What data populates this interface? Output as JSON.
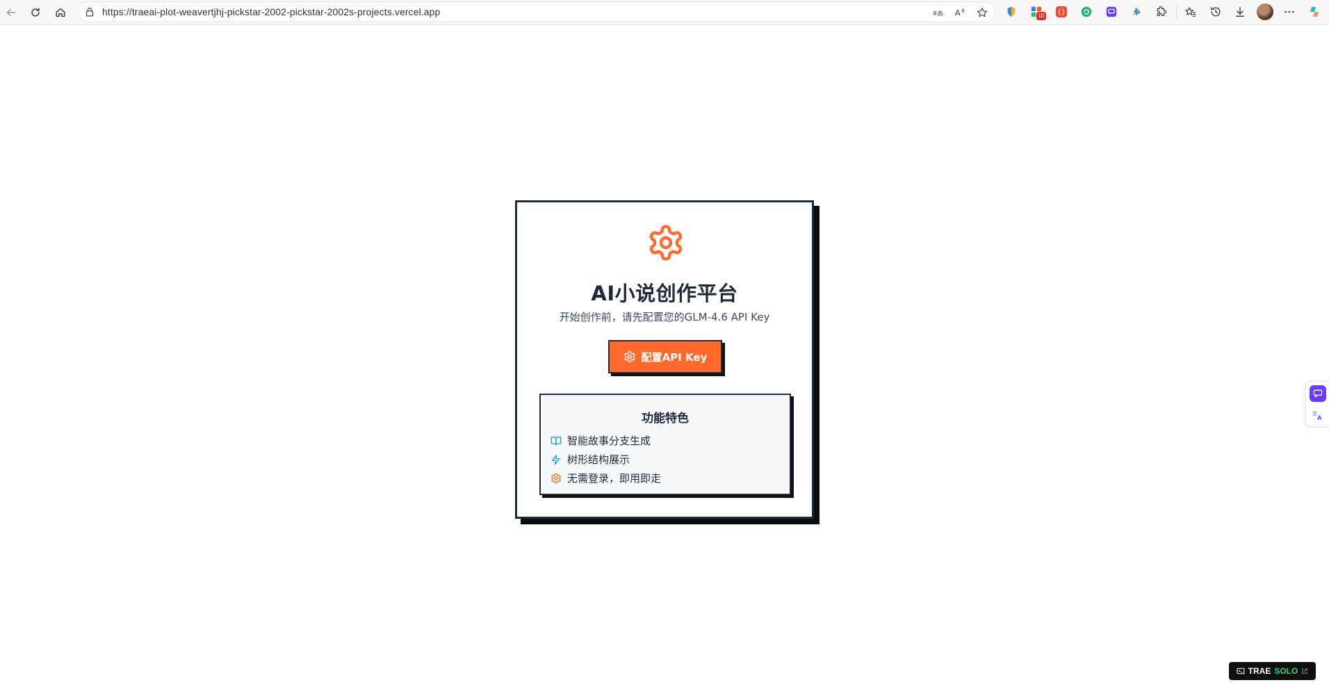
{
  "browser": {
    "url": "https://traeai-plot-weavertjhj-pickstar-2002-pickstar-2002s-projects.vercel.app",
    "extension_badge": "10"
  },
  "card": {
    "title": "AI小说创作平台",
    "subtitle": "开始创作前，请先配置您的GLM-4.6 API Key",
    "cta_label": "配置API Key",
    "features_title": "功能特色",
    "features": [
      {
        "icon": "book-open-icon",
        "label": "智能故事分支生成"
      },
      {
        "icon": "lightning-icon",
        "label": "树形结构展示"
      },
      {
        "icon": "gear-icon",
        "label": "无需登录，即用即走"
      }
    ]
  },
  "badge": {
    "brand": "TRAE",
    "mode": "SOLO"
  },
  "colors": {
    "accent": "#ff6a2c",
    "ink": "#1e2a3a",
    "teal": "#1aa7b8",
    "solo": "#32d27a"
  }
}
